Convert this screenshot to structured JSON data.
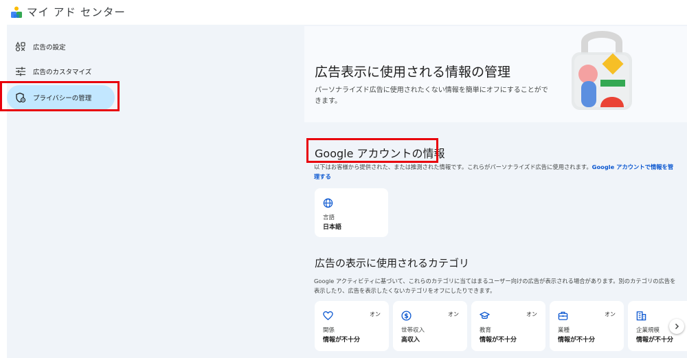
{
  "app": {
    "title": "マイ アド センター"
  },
  "sidebar": {
    "items": [
      {
        "label": "広告の設定",
        "icon": "ad-settings-icon"
      },
      {
        "label": "広告のカスタマイズ",
        "icon": "tune-icon"
      },
      {
        "label": "プライバシーの管理",
        "icon": "privacy-shield-icon",
        "active": true
      }
    ]
  },
  "hero": {
    "title": "広告表示に使用される情報の管理",
    "description": "パーソナライズド広告に使用されたくない情報を簡単にオフにすることができます。"
  },
  "account_info": {
    "title": "Google アカウントの情報",
    "description": "以下はお客様から提供された、または推測された情報です。これらがパーソナライズド広告に使用されます。",
    "link": "Google アカウントで情報を管理する",
    "cards": [
      {
        "icon": "globe-icon",
        "label": "言語",
        "value": "日本語"
      }
    ]
  },
  "categories": {
    "title": "広告の表示に使用されるカテゴリ",
    "description": "Google アクティビティに基づいて、これらのカテゴリに当てはまるユーザー向けの広告が表示される場合があります。別のカテゴリの広告を表示したり、広告を表示したくないカテゴリをオフにしたりできます。",
    "cards": [
      {
        "icon": "heart-icon",
        "status": "オン",
        "label": "関係",
        "value": "情報が不十分"
      },
      {
        "icon": "dollar-icon",
        "status": "オン",
        "label": "世帯収入",
        "value": "高収入"
      },
      {
        "icon": "school-icon",
        "status": "オン",
        "label": "教育",
        "value": "情報が不十分"
      },
      {
        "icon": "briefcase-icon",
        "status": "オン",
        "label": "業種",
        "value": "情報が不十分"
      },
      {
        "icon": "building-icon",
        "label": "企業規模",
        "value": "情報が不十分"
      }
    ]
  },
  "colors": {
    "accent": "#0b57d0",
    "active_nav": "#c2e7ff",
    "highlight": "#e8000b",
    "background": "#f0f4f9"
  }
}
